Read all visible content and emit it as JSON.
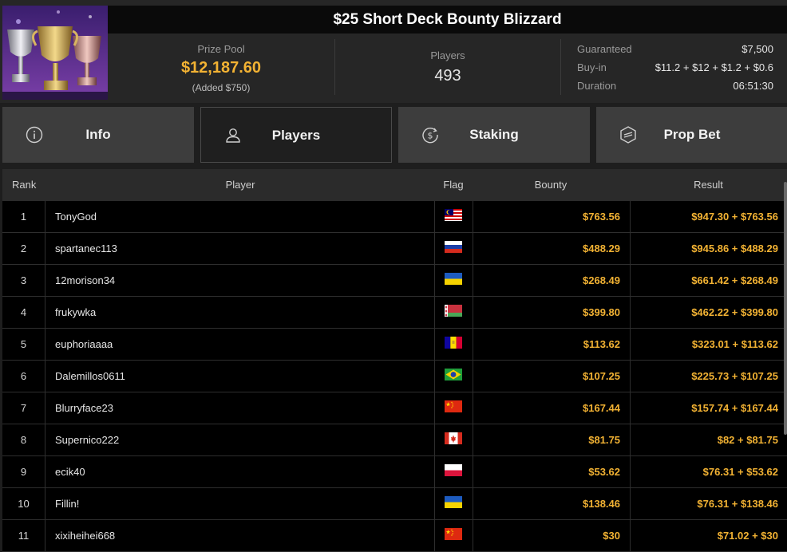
{
  "header": {
    "title": "$25 Short Deck Bounty Blizzard",
    "prize_pool_label": "Prize Pool",
    "prize_pool_value": "$12,187.60",
    "prize_pool_added": "(Added $750)",
    "players_label": "Players",
    "players_value": "493",
    "stats": [
      {
        "label": "Guaranteed",
        "value": "$7,500"
      },
      {
        "label": "Buy-in",
        "value": "$11.2 + $12 + $1.2 + $0.6"
      },
      {
        "label": "Duration",
        "value": "06:51:30"
      }
    ]
  },
  "tabs": [
    {
      "label": "Info",
      "icon": "info-icon",
      "active": false
    },
    {
      "label": "Players",
      "icon": "user-icon",
      "active": true
    },
    {
      "label": "Staking",
      "icon": "staking-dollar-icon",
      "active": false
    },
    {
      "label": "Prop Bet",
      "icon": "prop-bet-icon",
      "active": false
    }
  ],
  "table": {
    "columns": [
      "Rank",
      "Player",
      "Flag",
      "Bounty",
      "Result"
    ],
    "rows": [
      {
        "rank": "1",
        "player": "TonyGod",
        "flag": "my",
        "bounty": "$763.56",
        "result": "$947.30 + $763.56"
      },
      {
        "rank": "2",
        "player": "spartanec113",
        "flag": "ru",
        "bounty": "$488.29",
        "result": "$945.86 + $488.29"
      },
      {
        "rank": "3",
        "player": "12morison34",
        "flag": "ua",
        "bounty": "$268.49",
        "result": "$661.42 + $268.49"
      },
      {
        "rank": "4",
        "player": "frukywka",
        "flag": "by",
        "bounty": "$399.80",
        "result": "$462.22 + $399.80"
      },
      {
        "rank": "5",
        "player": "euphoriaaaa",
        "flag": "ad",
        "bounty": "$113.62",
        "result": "$323.01 + $113.62"
      },
      {
        "rank": "6",
        "player": "Dalemillos0611",
        "flag": "br",
        "bounty": "$107.25",
        "result": "$225.73 + $107.25"
      },
      {
        "rank": "7",
        "player": "Blurryface23",
        "flag": "cn",
        "bounty": "$167.44",
        "result": "$157.74 + $167.44"
      },
      {
        "rank": "8",
        "player": "Supernico222",
        "flag": "ca",
        "bounty": "$81.75",
        "result": "$82 + $81.75"
      },
      {
        "rank": "9",
        "player": "ecik40",
        "flag": "pl",
        "bounty": "$53.62",
        "result": "$76.31 + $53.62"
      },
      {
        "rank": "10",
        "player": "Fillin!",
        "flag": "ua",
        "bounty": "$138.46",
        "result": "$76.31 + $138.46"
      },
      {
        "rank": "11",
        "player": "xixiheihei668",
        "flag": "cn",
        "bounty": "$30",
        "result": "$71.02 + $30"
      }
    ]
  },
  "colors": {
    "accent_gold": "#f2b233",
    "background": "#1e1e1e",
    "table_bg": "#000000",
    "tab_bg": "#3d3d3d"
  }
}
